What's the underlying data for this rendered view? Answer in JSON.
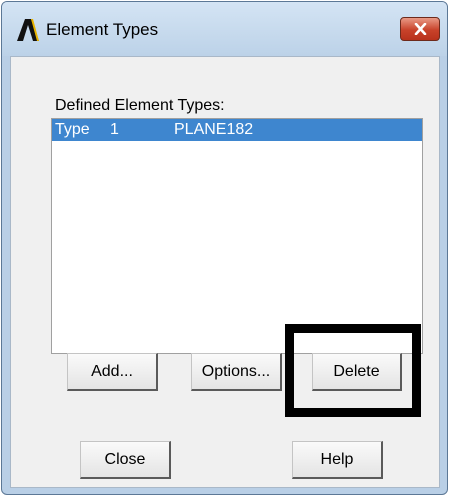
{
  "window": {
    "title": "Element Types"
  },
  "icons": {
    "app": "ansys-logo-icon",
    "close": "close-icon"
  },
  "dialog": {
    "list_label": "Defined Element Types:",
    "items": [
      {
        "type_label": "Type",
        "number": "1",
        "element": "PLANE182",
        "selected": true
      }
    ],
    "buttons": {
      "add": "Add...",
      "options": "Options...",
      "delete": "Delete",
      "close": "Close",
      "help": "Help"
    }
  },
  "colors": {
    "selection": "#3e86cf",
    "window_frame": "#b9cfe6",
    "close_button": "#c8422a",
    "highlight_annotation": "#000000"
  }
}
